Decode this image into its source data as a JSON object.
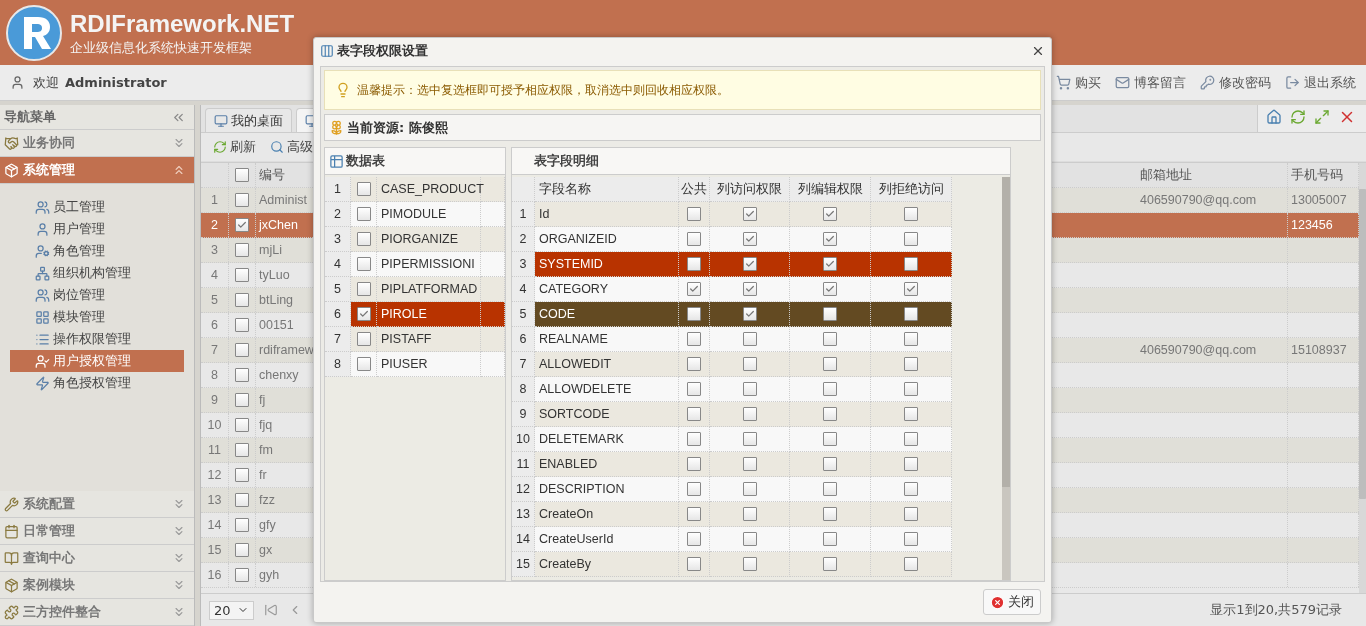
{
  "header": {
    "title": "RDIFramework.NET",
    "subtitle": "企业级信息化系统快速开发框架"
  },
  "userbar": {
    "welcome": "欢迎",
    "user": "Administrator",
    "links": [
      "购买",
      "博客留言",
      "修改密码",
      "退出系统"
    ]
  },
  "sidebar": {
    "title": "导航菜单",
    "sections": [
      {
        "label": "业务协同",
        "expanded": false,
        "selected": false
      },
      {
        "label": "系统管理",
        "expanded": true,
        "selected": true,
        "items": [
          {
            "label": "员工管理",
            "selected": false
          },
          {
            "label": "用户管理",
            "selected": false
          },
          {
            "label": "角色管理",
            "selected": false
          },
          {
            "label": "组织机构管理",
            "selected": false
          },
          {
            "label": "岗位管理",
            "selected": false
          },
          {
            "label": "模块管理",
            "selected": false
          },
          {
            "label": "操作权限管理",
            "selected": false
          },
          {
            "label": "用户授权管理",
            "selected": true
          },
          {
            "label": "角色授权管理",
            "selected": false
          }
        ]
      },
      {
        "label": "系统配置",
        "expanded": false,
        "selected": false
      },
      {
        "label": "日常管理",
        "expanded": false,
        "selected": false
      },
      {
        "label": "查询中心",
        "expanded": false,
        "selected": false
      },
      {
        "label": "案例模块",
        "expanded": false,
        "selected": false
      },
      {
        "label": "三方控件整合",
        "expanded": false,
        "selected": false
      }
    ]
  },
  "tabs": [
    {
      "label": "我的桌面",
      "selected": false
    },
    {
      "selected": true
    }
  ],
  "toolbar": [
    "刷新",
    "高级"
  ],
  "grid": {
    "columns": [
      "编号",
      "邮箱地址",
      "手机号码"
    ],
    "header_checked": false,
    "rows": [
      {
        "num": "1",
        "code": "Administ",
        "email": "406590790@qq.com",
        "phone": "13005007",
        "checked": false,
        "selected": false
      },
      {
        "num": "2",
        "code": "jxChen",
        "phone": "123456",
        "checked": true,
        "selected": true
      },
      {
        "num": "3",
        "code": "mjLi",
        "checked": false,
        "selected": false
      },
      {
        "num": "4",
        "code": "tyLuo",
        "checked": false,
        "selected": false
      },
      {
        "num": "5",
        "code": "btLing",
        "checked": false,
        "selected": false
      },
      {
        "num": "6",
        "code": "00151",
        "checked": false,
        "selected": false
      },
      {
        "num": "7",
        "code": "rdiframew",
        "email": "406590790@qq.com",
        "phone": "15108937",
        "checked": false,
        "selected": false
      },
      {
        "num": "8",
        "code": "chenxy",
        "checked": false,
        "selected": false
      },
      {
        "num": "9",
        "code": "fj",
        "checked": false,
        "selected": false
      },
      {
        "num": "10",
        "code": "fjq",
        "checked": false,
        "selected": false
      },
      {
        "num": "11",
        "code": "fm",
        "checked": false,
        "selected": false
      },
      {
        "num": "12",
        "code": "fr",
        "checked": false,
        "selected": false
      },
      {
        "num": "13",
        "code": "fzz",
        "checked": false,
        "selected": false
      },
      {
        "num": "14",
        "code": "gfy",
        "checked": false,
        "selected": false
      },
      {
        "num": "15",
        "code": "gx",
        "checked": false,
        "selected": false
      },
      {
        "num": "16",
        "code": "gyh",
        "checked": false,
        "selected": false
      }
    ]
  },
  "pager": {
    "page_size": "20",
    "summary": "显示1到20,共579记录"
  },
  "dialog": {
    "title": "表字段权限设置",
    "tip": "温馨提示：选中复选框即可授予相应权限，取消选中则回收相应权限。",
    "resource": "当前资源: 陈俊熙",
    "tables": {
      "title": "数据表",
      "rows": [
        {
          "num": "1",
          "name": "CASE_PRODUCT",
          "checked": false,
          "selected": false
        },
        {
          "num": "2",
          "name": "PIMODULE",
          "checked": false,
          "selected": false
        },
        {
          "num": "3",
          "name": "PIORGANIZE",
          "checked": false,
          "selected": false
        },
        {
          "num": "4",
          "name": "PIPERMISSIONI",
          "checked": false,
          "selected": false
        },
        {
          "num": "5",
          "name": "PIPLATFORMAD",
          "checked": false,
          "selected": false
        },
        {
          "num": "6",
          "name": "PIROLE",
          "checked": true,
          "selected": true
        },
        {
          "num": "7",
          "name": "PISTAFF",
          "checked": false,
          "selected": false
        },
        {
          "num": "8",
          "name": "PIUSER",
          "checked": false,
          "selected": false
        }
      ]
    },
    "fields": {
      "title": "表字段明细",
      "columns": [
        "字段名称",
        "公共",
        "列访问权限",
        "列编辑权限",
        "列拒绝访问"
      ],
      "rows": [
        {
          "num": "1",
          "name": "Id",
          "public": false,
          "access": true,
          "edit": true,
          "deny": false,
          "selected": false,
          "hovered": false
        },
        {
          "num": "2",
          "name": "ORGANIZEID",
          "public": false,
          "access": true,
          "edit": true,
          "deny": false,
          "selected": false,
          "hovered": false
        },
        {
          "num": "3",
          "name": "SYSTEMID",
          "public": false,
          "access": true,
          "edit": true,
          "deny": false,
          "selected": true,
          "hovered": false
        },
        {
          "num": "4",
          "name": "CATEGORY",
          "public": true,
          "access": true,
          "edit": true,
          "deny": true,
          "selected": false,
          "hovered": false
        },
        {
          "num": "5",
          "name": "CODE",
          "public": false,
          "access": true,
          "edit": false,
          "deny": false,
          "selected": false,
          "hovered": true
        },
        {
          "num": "6",
          "name": "REALNAME",
          "public": false,
          "access": false,
          "edit": false,
          "deny": false,
          "selected": false,
          "hovered": false
        },
        {
          "num": "7",
          "name": "ALLOWEDIT",
          "public": false,
          "access": false,
          "edit": false,
          "deny": false,
          "selected": false,
          "hovered": false
        },
        {
          "num": "8",
          "name": "ALLOWDELETE",
          "public": false,
          "access": false,
          "edit": false,
          "deny": false,
          "selected": false,
          "hovered": false
        },
        {
          "num": "9",
          "name": "SORTCODE",
          "public": false,
          "access": false,
          "edit": false,
          "deny": false,
          "selected": false,
          "hovered": false
        },
        {
          "num": "10",
          "name": "DELETEMARK",
          "public": false,
          "access": false,
          "edit": false,
          "deny": false,
          "selected": false,
          "hovered": false
        },
        {
          "num": "11",
          "name": "ENABLED",
          "public": false,
          "access": false,
          "edit": false,
          "deny": false,
          "selected": false,
          "hovered": false
        },
        {
          "num": "12",
          "name": "DESCRIPTION",
          "public": false,
          "access": false,
          "edit": false,
          "deny": false,
          "selected": false,
          "hovered": false
        },
        {
          "num": "13",
          "name": "CreateOn",
          "public": false,
          "access": false,
          "edit": false,
          "deny": false,
          "selected": false,
          "hovered": false
        },
        {
          "num": "14",
          "name": "CreateUserId",
          "public": false,
          "access": false,
          "edit": false,
          "deny": false,
          "selected": false,
          "hovered": false
        },
        {
          "num": "15",
          "name": "CreateBy",
          "public": false,
          "access": false,
          "edit": false,
          "deny": false,
          "selected": false,
          "hovered": false
        }
      ]
    },
    "close_button": "关闭"
  }
}
